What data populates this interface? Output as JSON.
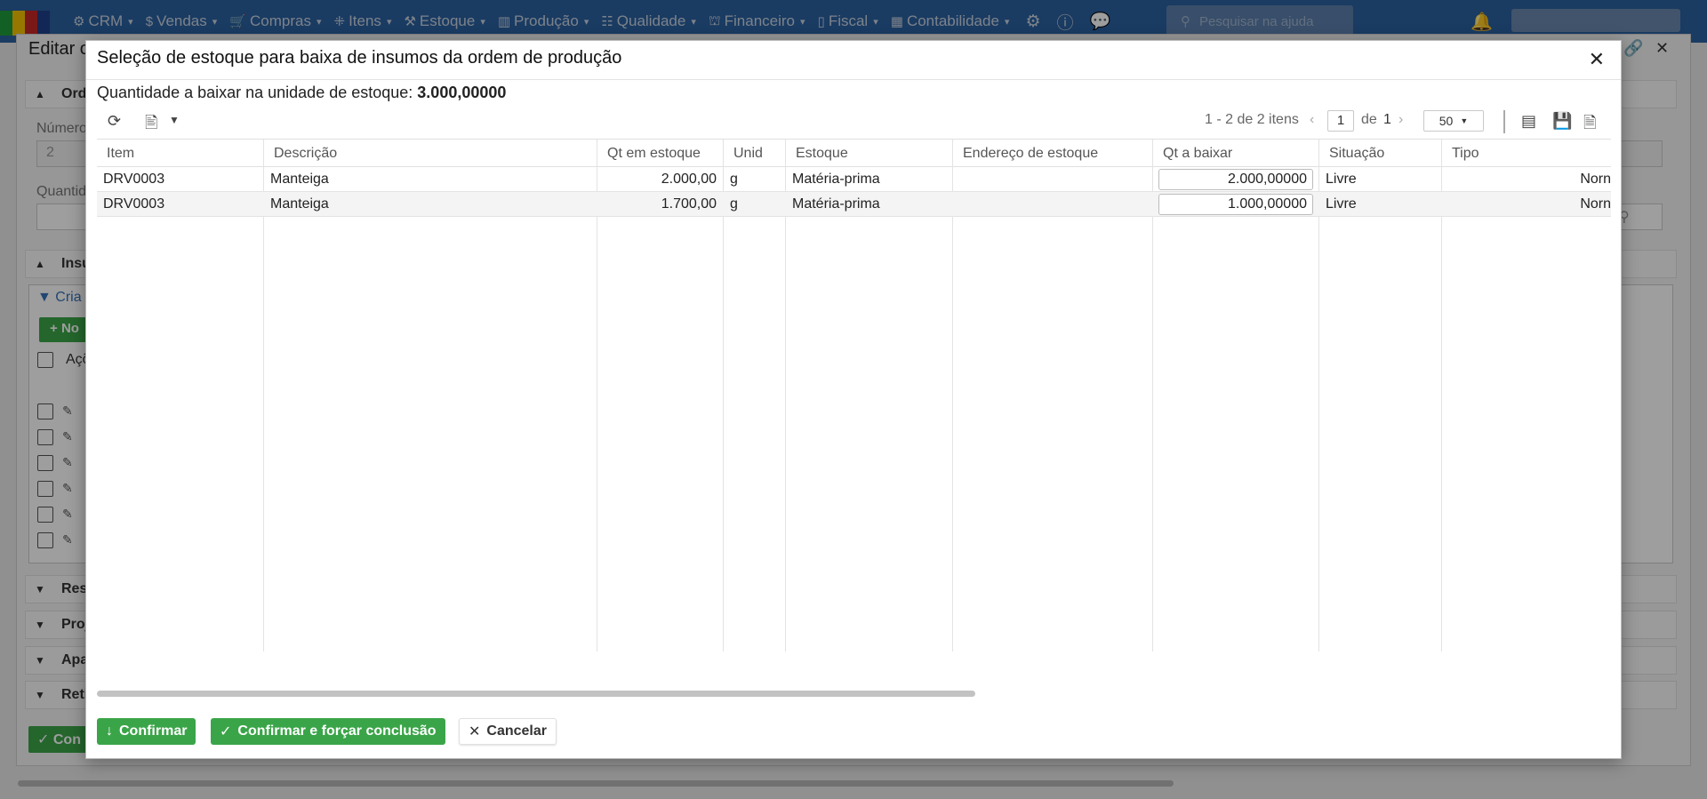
{
  "navbar": {
    "items": [
      {
        "label": "CRM",
        "icon": "crm-icon"
      },
      {
        "label": "Vendas",
        "icon": "dollar-icon"
      },
      {
        "label": "Compras",
        "icon": "cart-icon"
      },
      {
        "label": "Itens",
        "icon": "items-icon"
      },
      {
        "label": "Estoque",
        "icon": "stock-icon"
      },
      {
        "label": "Produção",
        "icon": "factory-icon"
      },
      {
        "label": "Qualidade",
        "icon": "quality-icon"
      },
      {
        "label": "Financeiro",
        "icon": "finance-icon"
      },
      {
        "label": "Fiscal",
        "icon": "fiscal-icon"
      },
      {
        "label": "Contabilidade",
        "icon": "accounting-icon"
      }
    ],
    "search_placeholder": "Pesquisar na ajuda",
    "colors": {
      "bar": "#2b5f9e",
      "text": "#c9d3e0"
    }
  },
  "background": {
    "title": "Editar o",
    "sections": [
      "Ord",
      "Insu",
      "Res",
      "Proj",
      "Apa",
      "Reti"
    ],
    "labels": {
      "numero": "Número",
      "quantidade": "Quantid"
    },
    "numero_value": "2",
    "filter_label": "Cria",
    "new_button": "No",
    "actions_header": "Açõ",
    "confirm_button": "Con"
  },
  "modal": {
    "title": "Seleção de estoque para baixa de insumos da ordem de produção",
    "qty_label": "Quantidade a baixar na unidade de estoque:",
    "qty_value": "3.000,00000",
    "pager": {
      "range_text": "1 - 2 de 2 itens",
      "page": "1",
      "of_label": "de",
      "total_pages": "1",
      "page_size": "50"
    },
    "columns": [
      "Item",
      "Descrição",
      "Qt em estoque",
      "Unid",
      "Estoque",
      "Endereço de estoque",
      "Qt a baixar",
      "Situação",
      "Tipo"
    ],
    "rows": [
      {
        "item": "DRV0003",
        "descricao": "Manteiga",
        "qt_estoque": "2.000,00",
        "unid": "g",
        "estoque": "Matéria-prima",
        "endereco": "",
        "qt_baixar": "2.000,00000",
        "situacao": "Livre",
        "tipo": "Norn"
      },
      {
        "item": "DRV0003",
        "descricao": "Manteiga",
        "qt_estoque": "1.700,00",
        "unid": "g",
        "estoque": "Matéria-prima",
        "endereco": "",
        "qt_baixar": "1.000,00000",
        "situacao": "Livre",
        "tipo": "Norn"
      }
    ],
    "buttons": {
      "confirm": "Confirmar",
      "confirm_force": "Confirmar e forçar conclusão",
      "cancel": "Cancelar"
    },
    "colors": {
      "accent_green": "#3aa548",
      "save_icon": "#2f6db5"
    }
  }
}
